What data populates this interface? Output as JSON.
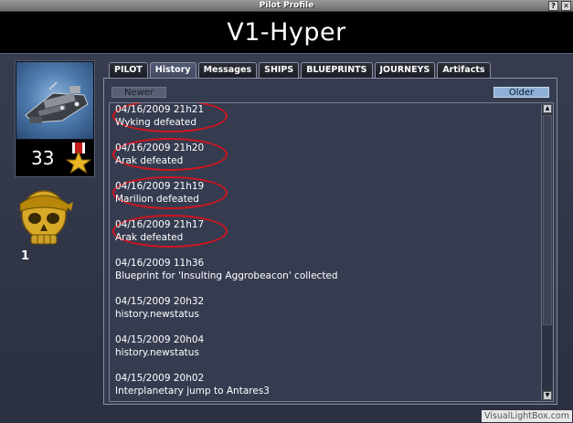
{
  "window": {
    "title": "Pilot Profile",
    "help_glyph": "?",
    "close_glyph": "✕"
  },
  "pilot": {
    "name": "V1-Hyper",
    "rank_level": "33",
    "skull_count": "1"
  },
  "tabs": [
    {
      "label": "PILOT",
      "active": false
    },
    {
      "label": "History",
      "active": true
    },
    {
      "label": "Messages",
      "active": false
    },
    {
      "label": "SHIPS",
      "active": false
    },
    {
      "label": "BLUEPRINTS",
      "active": false
    },
    {
      "label": "JOURNEYS",
      "active": false
    },
    {
      "label": "Artifacts",
      "active": false
    }
  ],
  "history": {
    "newer_label": "Newer",
    "older_label": "Older",
    "entries": [
      {
        "date": "04/16/2009 21h21",
        "event": "Wyking defeated",
        "highlighted": true
      },
      {
        "date": "04/16/2009 21h20",
        "event": "Arak defeated",
        "highlighted": true
      },
      {
        "date": "04/16/2009 21h19",
        "event": "Marilion defeated",
        "highlighted": true
      },
      {
        "date": "04/16/2009 21h17",
        "event": "Arak defeated",
        "highlighted": true
      },
      {
        "date": "04/16/2009 11h36",
        "event": "Blueprint for 'Insulting Aggrobeacon' collected",
        "highlighted": false
      },
      {
        "date": "04/15/2009 20h32",
        "event": "history.newstatus",
        "highlighted": false
      },
      {
        "date": "04/15/2009 20h04",
        "event": "history.newstatus",
        "highlighted": false
      },
      {
        "date": "04/15/2009 20h02",
        "event": "Interplanetary jump to Antares3",
        "highlighted": false
      }
    ]
  },
  "colors": {
    "highlight_ring": "#d2141e",
    "older_button": "#8fb0d6"
  },
  "watermark": "VisualLightBox.com"
}
